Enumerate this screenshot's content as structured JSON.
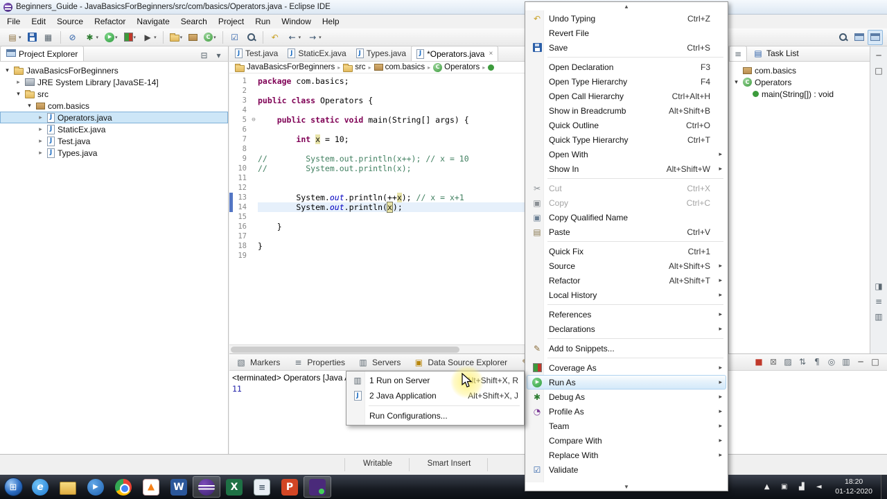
{
  "window": {
    "title": "Beginners_Guide - JavaBasicsForBeginners/src/com/basics/Operators.java - Eclipse IDE"
  },
  "menu_bar": {
    "items": [
      "File",
      "Edit",
      "Source",
      "Refactor",
      "Navigate",
      "Search",
      "Project",
      "Run",
      "Window",
      "Help"
    ]
  },
  "toolbar": {
    "left_buttons": [
      {
        "icon": "new",
        "dropdown": true
      },
      {
        "icon": "save"
      },
      {
        "icon": "print"
      },
      {
        "sep": true
      },
      {
        "icon": "skip-breakpoints"
      },
      {
        "icon": "debug",
        "dropdown": true
      },
      {
        "icon": "run",
        "dropdown": true
      },
      {
        "icon": "coverage",
        "dropdown": true
      },
      {
        "icon": "external-tools",
        "dropdown": true
      },
      {
        "sep": true
      },
      {
        "icon": "new-java-project",
        "dropdown": true
      },
      {
        "icon": "new-package"
      },
      {
        "icon": "new-class",
        "dropdown": true
      },
      {
        "sep": true
      },
      {
        "icon": "open-task"
      },
      {
        "icon": "search"
      },
      {
        "sep": true
      },
      {
        "icon": "last-edit-location"
      },
      {
        "icon": "back",
        "dropdown": true
      },
      {
        "icon": "forward",
        "dropdown": true
      }
    ],
    "right_buttons": [
      {
        "icon": "quick-search"
      },
      {
        "icon": "open-perspective"
      },
      {
        "icon": "java-perspective",
        "active": true
      }
    ]
  },
  "project_explorer": {
    "title": "Project Explorer",
    "toolbar_icons": [
      "collapse-all",
      "view-menu"
    ],
    "tree": [
      {
        "label": "JavaBasicsForBeginners",
        "icon": "java-project",
        "depth": 0,
        "expander": "expanded"
      },
      {
        "label": "JRE System Library [JavaSE-14]",
        "icon": "library",
        "depth": 1,
        "expander": "collapsed"
      },
      {
        "label": "src",
        "icon": "source-folder",
        "depth": 1,
        "expander": "expanded"
      },
      {
        "label": "com.basics",
        "icon": "package",
        "depth": 2,
        "expander": "expanded"
      },
      {
        "label": "Operators.java",
        "icon": "java-file",
        "depth": 3,
        "expander": "collapsed",
        "selected": true
      },
      {
        "label": "StaticEx.java",
        "icon": "java-file",
        "depth": 3,
        "expander": "collapsed"
      },
      {
        "label": "Test.java",
        "icon": "java-file",
        "depth": 3,
        "expander": "collapsed"
      },
      {
        "label": "Types.java",
        "icon": "java-file",
        "depth": 3,
        "expander": "collapsed"
      }
    ]
  },
  "editor": {
    "tabs": [
      {
        "label": "Test.java",
        "icon": "java-file",
        "active": false
      },
      {
        "label": "StaticEx.java",
        "icon": "java-file",
        "active": false
      },
      {
        "label": "Types.java",
        "icon": "java-file",
        "active": false
      },
      {
        "label": "*Operators.java",
        "icon": "java-file",
        "active": true
      }
    ],
    "breadcrumb": [
      {
        "label": "JavaBasicsForBeginners",
        "icon": "java-project"
      },
      {
        "label": "src",
        "icon": "source-folder"
      },
      {
        "label": "com.basics",
        "icon": "package"
      },
      {
        "label": "Operators",
        "icon": "class"
      },
      {
        "label": "",
        "icon": "method"
      }
    ],
    "code_lines": [
      {
        "n": 1,
        "tokens": [
          [
            "package",
            "kw"
          ],
          [
            " com.basics;",
            "pl"
          ]
        ]
      },
      {
        "n": 2,
        "tokens": []
      },
      {
        "n": 3,
        "tokens": [
          [
            "public class",
            "kw"
          ],
          [
            " Operators {",
            "pl"
          ]
        ]
      },
      {
        "n": 4,
        "tokens": []
      },
      {
        "n": 5,
        "fold": true,
        "tokens": [
          [
            "    ",
            "pl"
          ],
          [
            "public static void",
            "kw"
          ],
          [
            " main(String[] args) {",
            "pl"
          ]
        ]
      },
      {
        "n": 6,
        "tokens": []
      },
      {
        "n": 7,
        "tokens": [
          [
            "        ",
            "pl"
          ],
          [
            "int",
            "kw"
          ],
          [
            " ",
            "pl"
          ],
          [
            "x",
            "occ"
          ],
          [
            " = 10;",
            "pl"
          ]
        ]
      },
      {
        "n": 8,
        "tokens": []
      },
      {
        "n": 9,
        "tokens": [
          [
            "//        System.out.println(x++); // x = 10",
            "cm"
          ]
        ]
      },
      {
        "n": 10,
        "tokens": [
          [
            "//        System.out.println(x);",
            "cm"
          ]
        ]
      },
      {
        "n": 11,
        "tokens": []
      },
      {
        "n": 12,
        "tokens": []
      },
      {
        "n": 13,
        "chg": true,
        "tokens": [
          [
            "        System.",
            "pl"
          ],
          [
            "out",
            "fld"
          ],
          [
            ".println(++",
            "pl"
          ],
          [
            "x",
            "occ"
          ],
          [
            "); ",
            "pl"
          ],
          [
            "// x = x+1",
            "cm"
          ]
        ]
      },
      {
        "n": 14,
        "chg": true,
        "current": true,
        "tokens": [
          [
            "        System.",
            "pl"
          ],
          [
            "out",
            "fld"
          ],
          [
            ".println(",
            "pl"
          ],
          [
            "x",
            "occbox"
          ],
          [
            ");",
            "pl"
          ]
        ]
      },
      {
        "n": 15,
        "tokens": []
      },
      {
        "n": 16,
        "tokens": [
          [
            "    }",
            "pl"
          ]
        ]
      },
      {
        "n": 17,
        "tokens": []
      },
      {
        "n": 18,
        "tokens": [
          [
            "}",
            "pl"
          ]
        ]
      },
      {
        "n": 19,
        "tokens": []
      }
    ]
  },
  "outline_panel": {
    "tabs": [
      {
        "label": "",
        "icon": "outline"
      },
      {
        "label": "Task List",
        "icon": "task-list"
      }
    ],
    "rows": [
      {
        "label": "com.basics",
        "icon": "package",
        "depth": 0
      },
      {
        "label": "Operators",
        "icon": "class",
        "depth": 0,
        "expander": "expanded"
      },
      {
        "label": "main(String[]) : void",
        "icon": "method",
        "depth": 1
      }
    ]
  },
  "right_strip": {
    "top_icons": [
      "minimize",
      "maximize"
    ],
    "view_icons": [
      "restore-views",
      "outline-view",
      "console-view"
    ]
  },
  "bottom_panel": {
    "tabs": [
      {
        "label": "Markers",
        "icon": "markers"
      },
      {
        "label": "Properties",
        "icon": "properties"
      },
      {
        "label": "Servers",
        "icon": "servers"
      },
      {
        "label": "Data Source Explorer",
        "icon": "data-source"
      },
      {
        "label": "Snippets",
        "icon": "snippets"
      },
      {
        "label": "",
        "icon": "console"
      }
    ],
    "toolbar_icons": [
      "stop",
      "remove-launches",
      "clear-console",
      "scroll-lock",
      "word-wrap",
      "pin-console",
      "open-console",
      "minimize",
      "maximize"
    ],
    "console_title": "<terminated> Operators [Java App",
    "console_output": "11"
  },
  "context_menu": {
    "groups": [
      {
        "items": [
          {
            "label": "Undo Typing",
            "shortcut": "Ctrl+Z",
            "icon": "undo"
          },
          {
            "label": "Revert File"
          },
          {
            "label": "Save",
            "shortcut": "Ctrl+S",
            "icon": "save"
          }
        ]
      },
      {
        "items": [
          {
            "label": "Open Declaration",
            "shortcut": "F3"
          },
          {
            "label": "Open Type Hierarchy",
            "shortcut": "F4"
          },
          {
            "label": "Open Call Hierarchy",
            "shortcut": "Ctrl+Alt+H"
          },
          {
            "label": "Show in Breadcrumb",
            "shortcut": "Alt+Shift+B"
          },
          {
            "label": "Quick Outline",
            "shortcut": "Ctrl+O"
          },
          {
            "label": "Quick Type Hierarchy",
            "shortcut": "Ctrl+T"
          },
          {
            "label": "Open With",
            "submenu": true
          },
          {
            "label": "Show In",
            "shortcut": "Alt+Shift+W",
            "submenu": true
          }
        ]
      },
      {
        "items": [
          {
            "label": "Cut",
            "shortcut": "Ctrl+X",
            "icon": "cut",
            "disabled": true
          },
          {
            "label": "Copy",
            "shortcut": "Ctrl+C",
            "icon": "copy",
            "disabled": true
          },
          {
            "label": "Copy Qualified Name",
            "icon": "copy-qualified"
          },
          {
            "label": "Paste",
            "shortcut": "Ctrl+V",
            "icon": "paste"
          }
        ]
      },
      {
        "items": [
          {
            "label": "Quick Fix",
            "shortcut": "Ctrl+1"
          },
          {
            "label": "Source",
            "shortcut": "Alt+Shift+S",
            "submenu": true
          },
          {
            "label": "Refactor",
            "shortcut": "Alt+Shift+T",
            "submenu": true
          },
          {
            "label": "Local History",
            "submenu": true
          }
        ]
      },
      {
        "items": [
          {
            "label": "References",
            "submenu": true
          },
          {
            "label": "Declarations",
            "submenu": true
          }
        ]
      },
      {
        "items": [
          {
            "label": "Add to Snippets...",
            "icon": "snippets"
          }
        ]
      },
      {
        "items": [
          {
            "label": "Coverage As",
            "icon": "coverage",
            "submenu": true
          },
          {
            "label": "Run As",
            "icon": "run",
            "submenu": true,
            "highlighted": true
          },
          {
            "label": "Debug As",
            "icon": "debug",
            "submenu": true
          },
          {
            "label": "Profile As",
            "icon": "profile",
            "submenu": true
          },
          {
            "label": "Team",
            "submenu": true
          },
          {
            "label": "Compare With",
            "submenu": true
          },
          {
            "label": "Replace With",
            "submenu": true
          },
          {
            "label": "Validate",
            "icon": "validate"
          }
        ]
      }
    ]
  },
  "run_as_submenu": {
    "items": [
      {
        "label": "1 Run on Server",
        "shortcut": "Alt+Shift+X, R",
        "icon": "server"
      },
      {
        "label": "2 Java Application",
        "shortcut": "Alt+Shift+X, J",
        "icon": "java-app"
      }
    ],
    "footer": {
      "label": "Run Configurations..."
    }
  },
  "status_bar": {
    "writable": "Writable",
    "input_mode": "Smart Insert"
  },
  "taskbar": {
    "apps": [
      {
        "name": "internet-explorer"
      },
      {
        "name": "file-explorer"
      },
      {
        "name": "media-player"
      },
      {
        "name": "chrome"
      },
      {
        "name": "vlc"
      },
      {
        "name": "word"
      },
      {
        "name": "eclipse",
        "active": true
      },
      {
        "name": "excel"
      },
      {
        "name": "notepad"
      },
      {
        "name": "powerpoint"
      },
      {
        "name": "screen-recorder",
        "active": true
      }
    ],
    "tray_icons": [
      "hidden-icons",
      "tray-app",
      "network",
      "volume"
    ],
    "clock": {
      "time": "18:20",
      "date": "01-12-2020"
    }
  },
  "colors": {
    "keyword": "#7f0055",
    "comment": "#3f7f5f",
    "static_field": "#0000c0",
    "current_line": "#e6f0fb",
    "occurrence": "#e8e3a8",
    "selection": "#cde6f7",
    "menu_highlight": "#d3e9fa",
    "run_green": "#2e9b3f"
  }
}
